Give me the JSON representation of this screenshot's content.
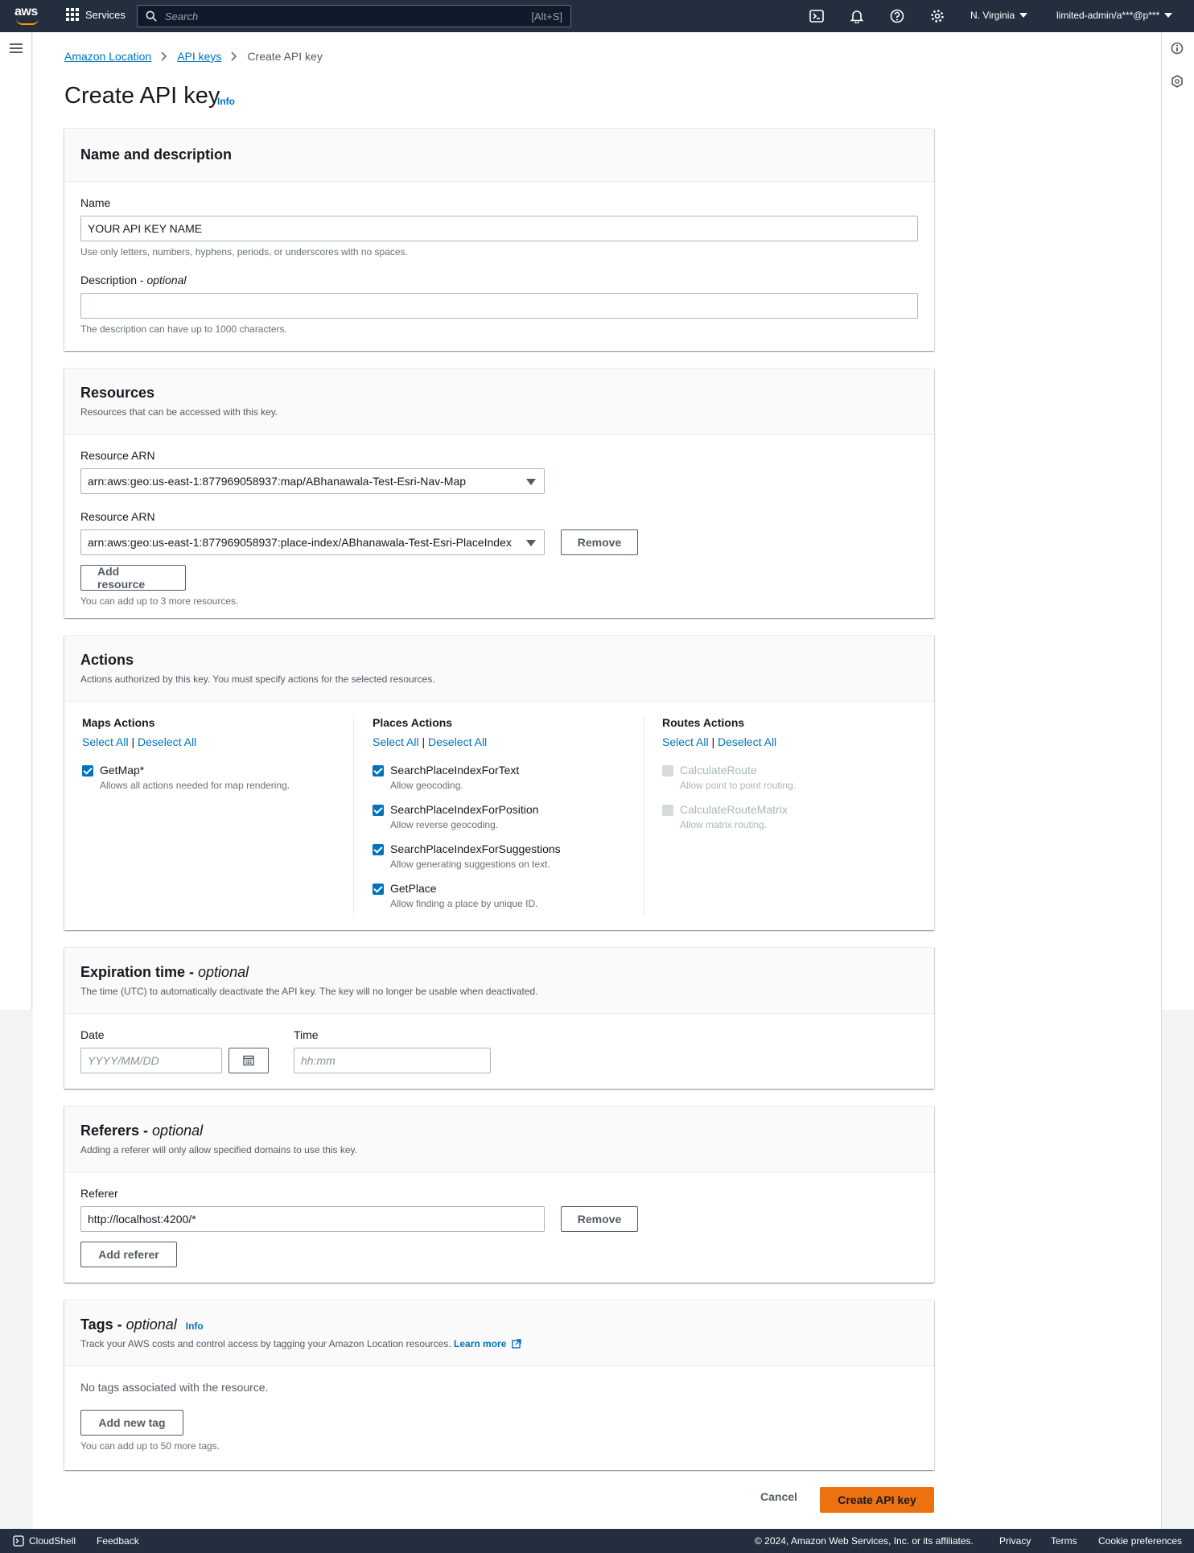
{
  "topnav": {
    "logo": "aws",
    "services": "Services",
    "search_placeholder": "Search",
    "search_shortcut": "[Alt+S]",
    "region": "N. Virginia",
    "account": "limited-admin/a***@p***"
  },
  "breadcrumb": {
    "items": [
      "Amazon Location",
      "API keys"
    ],
    "current": "Create API key"
  },
  "page": {
    "title": "Create API key",
    "info": "Info"
  },
  "name_section": {
    "title": "Name and description",
    "name_label": "Name",
    "name_value": "YOUR API KEY NAME",
    "name_hint": "Use only letters, numbers, hyphens, periods, or underscores with no spaces.",
    "desc_label": "Description - ",
    "desc_label_opt": "optional",
    "desc_value": "",
    "desc_hint": "The description can have up to 1000 characters."
  },
  "resources": {
    "title": "Resources",
    "description": "Resources that can be accessed with this key.",
    "arn_label": "Resource ARN",
    "arns": [
      "arn:aws:geo:us-east-1:877969058937:map/ABhanawala-Test-Esri-Nav-Map",
      "arn:aws:geo:us-east-1:877969058937:place-index/ABhanawala-Test-Esri-PlaceIndex"
    ],
    "remove": "Remove",
    "add_resource": "Add resource",
    "hint": "You can add up to 3 more resources."
  },
  "actions": {
    "title": "Actions",
    "description": "Actions authorized by this key. You must specify actions for the selected resources.",
    "select_all": "Select All",
    "deselect_all": "Deselect All",
    "separator": "|",
    "maps": {
      "title": "Maps Actions",
      "items": [
        {
          "name": "GetMap*",
          "desc": "Allows all actions needed for map rendering."
        }
      ]
    },
    "places": {
      "title": "Places Actions",
      "items": [
        {
          "name": "SearchPlaceIndexForText",
          "desc": "Allow geocoding."
        },
        {
          "name": "SearchPlaceIndexForPosition",
          "desc": "Allow reverse geocoding."
        },
        {
          "name": "SearchPlaceIndexForSuggestions",
          "desc": "Allow generating suggestions on text."
        },
        {
          "name": "GetPlace",
          "desc": "Allow finding a place by unique ID."
        }
      ]
    },
    "routes": {
      "title": "Routes Actions",
      "items": [
        {
          "name": "CalculateRoute",
          "desc": "Allow point to point routing."
        },
        {
          "name": "CalculateRouteMatrix",
          "desc": "Allow matrix routing."
        }
      ]
    }
  },
  "expiration": {
    "title": "Expiration time - ",
    "title_opt": "optional",
    "description": "The time (UTC) to automatically deactivate the API key. The key will no longer be usable when deactivated.",
    "date_label": "Date",
    "date_placeholder": "YYYY/MM/DD",
    "time_label": "Time",
    "time_placeholder": "hh:mm"
  },
  "referers": {
    "title": "Referers - ",
    "title_opt": "optional",
    "description": "Adding a referer will only allow specified domains to use this key.",
    "label": "Referer",
    "value": "http://localhost:4200/*",
    "remove": "Remove",
    "add": "Add referer"
  },
  "tags": {
    "title": "Tags - ",
    "title_opt": "optional",
    "info": "Info",
    "description": "Track your AWS costs and control access by tagging your Amazon Location resources.",
    "learn_more": "Learn more",
    "empty": "No tags associated with the resource.",
    "add": "Add new tag",
    "hint": "You can add up to 50 more tags."
  },
  "footer_actions": {
    "cancel": "Cancel",
    "create": "Create API key"
  },
  "bottombar": {
    "cloudshell": "CloudShell",
    "feedback": "Feedback",
    "copyright": "© 2024, Amazon Web Services, Inc. or its affiliates.",
    "privacy": "Privacy",
    "terms": "Terms",
    "cookie": "Cookie preferences"
  },
  "colors": {
    "nav_bg": "#232f3e",
    "link": "#0073bb",
    "primary": "#ec7211",
    "brand_smile": "#ff9900"
  }
}
